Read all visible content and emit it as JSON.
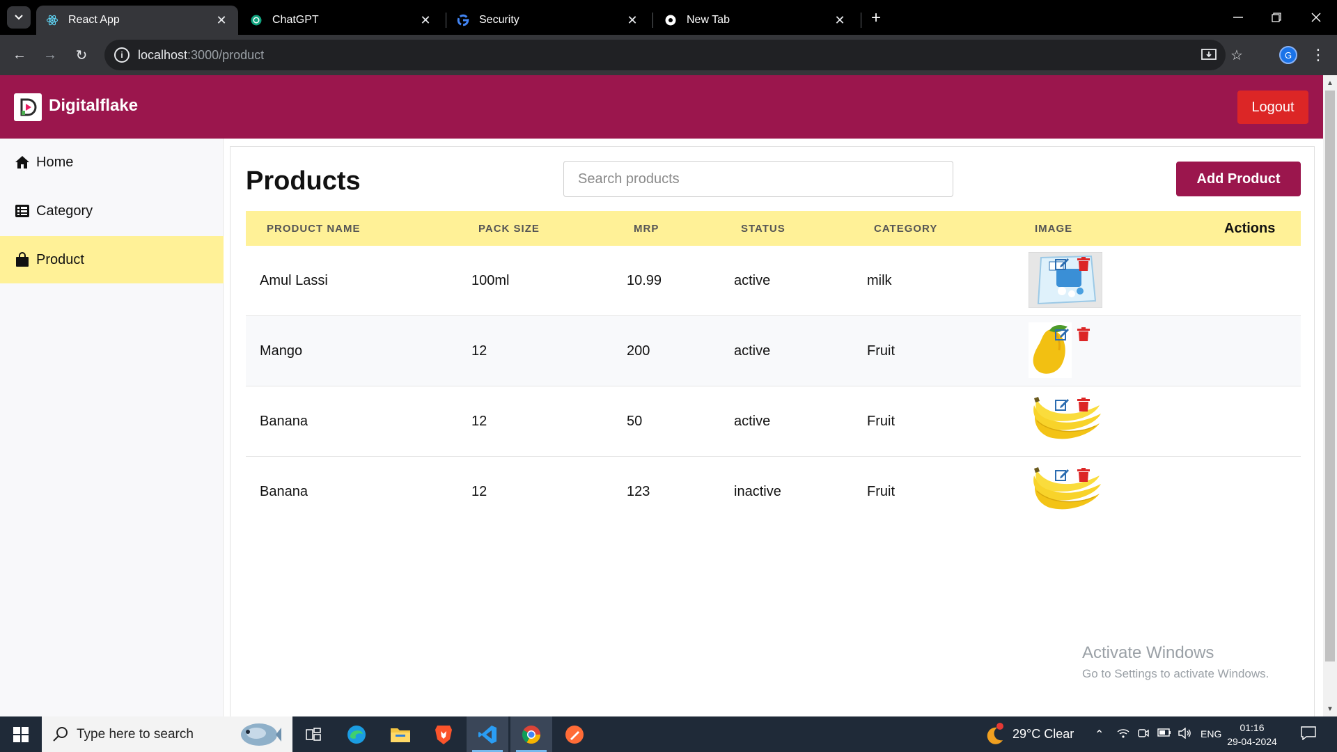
{
  "browser": {
    "tabs": [
      {
        "title": "React App",
        "active": true
      },
      {
        "title": "ChatGPT",
        "active": false
      },
      {
        "title": "Security",
        "active": false
      },
      {
        "title": "New Tab",
        "active": false
      }
    ],
    "url_host": "localhost",
    "url_path": ":3000/product",
    "profile_initial": "G"
  },
  "header": {
    "brand": "Digitalflake",
    "logout_label": "Logout"
  },
  "sidebar": {
    "items": [
      {
        "label": "Home",
        "icon": "home-icon",
        "active": false
      },
      {
        "label": "Category",
        "icon": "list-icon",
        "active": false
      },
      {
        "label": "Product",
        "icon": "shopping-bag-icon",
        "active": true
      }
    ]
  },
  "main": {
    "title": "Products",
    "search_placeholder": "Search products",
    "add_label": "Add Product"
  },
  "table": {
    "columns": [
      "PRODUCT NAME",
      "PACK SIZE",
      "MRP",
      "STATUS",
      "CATEGORY",
      "IMAGE",
      "Actions"
    ],
    "rows": [
      {
        "name": "Amul Lassi",
        "pack_size": "100ml",
        "mrp": "10.99",
        "status": "active",
        "category": "milk",
        "image": "lassi-pack-image"
      },
      {
        "name": "Mango",
        "pack_size": "12",
        "mrp": "200",
        "status": "active",
        "category": "Fruit",
        "image": "mango-image"
      },
      {
        "name": "Banana",
        "pack_size": "12",
        "mrp": "50",
        "status": "active",
        "category": "Fruit",
        "image": "banana-image"
      },
      {
        "name": "Banana",
        "pack_size": "12",
        "mrp": "123",
        "status": "inactive",
        "category": "Fruit",
        "image": "banana-image"
      }
    ]
  },
  "watermark": {
    "line1": "Activate Windows",
    "line2": "Go to Settings to activate Windows."
  },
  "taskbar": {
    "search_placeholder": "Type here to search",
    "weather": "29°C  Clear",
    "language": "ENG",
    "time": "01:16",
    "date": "29-04-2024"
  },
  "colors": {
    "brand": "#9b164d",
    "highlight": "#fff197",
    "danger": "#dc2626",
    "edit": "#2b6cb0"
  }
}
